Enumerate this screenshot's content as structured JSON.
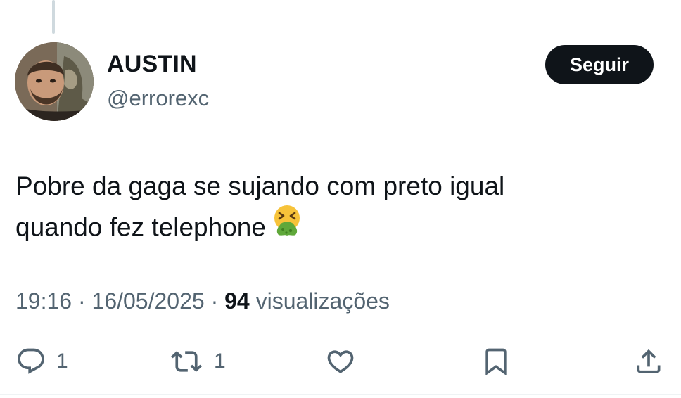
{
  "author": {
    "display_name": "AUSTIN",
    "handle": "@errorexc",
    "avatar_alt": "profile-photo"
  },
  "follow_button": {
    "label": "Seguir"
  },
  "tweet": {
    "text_line1": "Pobre da gaga se sujando com preto igual",
    "text_line2": "quando fez telephone",
    "emoji": "face-vomiting-emoji"
  },
  "meta": {
    "time": "19:16",
    "separator": " · ",
    "date": "16/05/2025",
    "views_count": "94",
    "views_label": "visualizações"
  },
  "actions": {
    "reply": {
      "icon": "reply-icon",
      "count": "1"
    },
    "repost": {
      "icon": "repost-icon",
      "count": "1"
    },
    "like": {
      "icon": "heart-icon",
      "count": ""
    },
    "bookmark": {
      "icon": "bookmark-icon"
    },
    "share": {
      "icon": "share-icon"
    }
  },
  "colors": {
    "text_primary": "#0f1419",
    "text_secondary": "#536471",
    "button_bg": "#0f1419",
    "button_text": "#ffffff",
    "thread_line": "#cfd9de"
  }
}
